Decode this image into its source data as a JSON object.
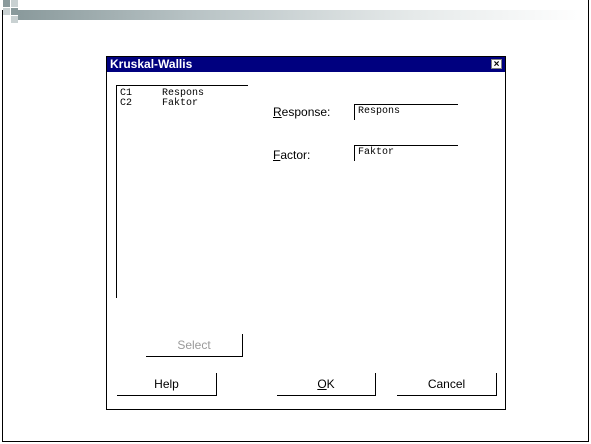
{
  "dialog": {
    "title": "Kruskal-Wallis",
    "close_glyph": "×",
    "variables": [
      {
        "column": "C1",
        "name": "Respons"
      },
      {
        "column": "C2",
        "name": "Faktor"
      }
    ],
    "response": {
      "label_mnemonic": "R",
      "label_rest": "esponse:",
      "value": "Respons"
    },
    "factor": {
      "label_mnemonic": "F",
      "label_rest": "actor:",
      "value": "Faktor"
    },
    "buttons": {
      "select": "Select",
      "help": "Help",
      "ok_mnemonic": "O",
      "ok_rest": "K",
      "cancel": "Cancel"
    }
  },
  "colors": {
    "titlebar": "#00007f",
    "deco_square_dark": "#8a9a9c",
    "deco_square_light": "#c9d1d2"
  }
}
